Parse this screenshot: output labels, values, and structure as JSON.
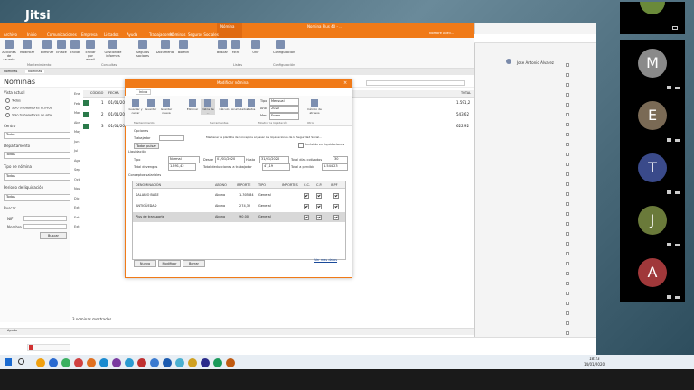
{
  "jitsi": {
    "logo": "Jitsi"
  },
  "app": {
    "title_center": "Nomina Plus 40 - ...",
    "title_right": "Nombre Apell...",
    "context_tab": "Nómina",
    "ribbon_tabs": [
      "Archivo",
      "Inicio",
      "Comunicaciones",
      "Empresa",
      "Listados",
      "Ayuda",
      "Trabajadores",
      "Nóminas",
      "Seguros Sociales",
      "Nómina"
    ],
    "ribbon_buttons": [
      "Acciones de usuario",
      "Modificar",
      "Eliminar",
      "Enlace",
      "Enviar",
      "Enviar por email",
      "Gestión de informes",
      "Seguros sociales",
      "Documento",
      "Boletín",
      "Buscar",
      "Filtro",
      "Unir",
      "Configuración"
    ],
    "ribbon_groups": [
      "Mantenimiento",
      "Consultas",
      "Listas",
      "Configuración"
    ],
    "doc_tabs": [
      "Nóminas",
      "Nóminas"
    ],
    "module_title": "Nominas",
    "filters": {
      "view_label": "Vista actual",
      "radio1": "Todos",
      "radio2": "Solo trabajadores activos",
      "radio3": "Solo trabajadores de alta",
      "centro_label": "Centro",
      "centro_value": "Todos",
      "depto_label": "Departamento",
      "depto_value": "Todos",
      "tipo_label": "Tipo de nómina",
      "tipo_value": "Todos",
      "periodo_label": "Periodo de liquidación",
      "periodo_value": "Todos",
      "buscar_label": "Buscar",
      "nif_label": "NIF",
      "nombre_label": "Nombre",
      "buscar_button": "Buscar"
    },
    "grid": {
      "headers": [
        "CÓDIGO",
        "FECHA"
      ],
      "rows": [
        {
          "code": "1",
          "date": "01/01/2020"
        },
        {
          "code": "2",
          "date": "01/01/2020"
        },
        {
          "code": "3",
          "date": "01/01/2020"
        }
      ],
      "totals_header": "TOTAL",
      "totals": [
        "1.591,2",
        "543,62",
        "622,92"
      ],
      "left_col": [
        "Ene",
        "Feb",
        "Mar",
        "Abr",
        "May",
        "Jun",
        "Jul",
        "Ago",
        "Sep",
        "Oct",
        "Nov",
        "Dic",
        "Ext.",
        "Ext.",
        "Ext."
      ]
    },
    "status_bar": "3 nominas mostradas",
    "ayuda": "Ayuda"
  },
  "dialog": {
    "title": "Modificar nómina",
    "tab": "Inicio",
    "toolbar": [
      "Guardar y cerrar",
      "Guardar",
      "Guardar nueva",
      "Eliminar",
      "Datos de ...",
      "Cálculo",
      "Acumulados",
      "Datos",
      "Ver detalle",
      "Cálculo de atrasos"
    ],
    "tipo_label": "Tipo",
    "tipo_value": "Mensual",
    "ano_label": "Año",
    "ano_value": "2020",
    "mes_label": "Mes",
    "mes_value": "Enero",
    "groups": [
      "Mantenimiento",
      "Herramientas",
      "Mostrar la liquidación",
      "Otros"
    ],
    "options_label": "Opciones",
    "trabajador_label": "Trabajador",
    "todos_button": "Todos pulsar",
    "note": "Mantener la plantilla de conceptos al pasar las liquidaciones de la Seguridad Social...",
    "incluida": "Incluida en liquidaciones",
    "liquidacion_label": "Liquidación",
    "tipo2_label": "Tipo",
    "tipo2_value": "Normal",
    "desde_label": "Desde",
    "desde_value": "01/01/2020",
    "hasta_label": "Hasta",
    "hasta_value": "31/01/2020",
    "dias_label": "Total días cotizados",
    "dias_value": "30",
    "total_devengos_label": "Total devengos",
    "total_devengos_value": "1.591,42",
    "total_deducciones_label": "Total deducciones a trabajador",
    "total_deducciones_value": "47,19",
    "total_percibir_label": "Total a percibir",
    "total_percibir_value": "1.544,23",
    "conceptos_label": "Conceptos salariales",
    "table_headers": [
      "DENOMINACIÓN",
      "ABONO",
      "IMPORTE",
      "TIPO",
      "IMPORTES",
      "C.C.",
      "C.P.",
      "IRPF"
    ],
    "table_rows": [
      {
        "name": "SALARIO BASE",
        "abono": "Abono",
        "importe": "1.305,84",
        "tipo": "General"
      },
      {
        "name": "ANTIGÜEDAD",
        "abono": "Abono",
        "importe": "274,32",
        "tipo": "General"
      },
      {
        "name": "Plus de transporte",
        "abono": "Abono",
        "importe": "90,00",
        "tipo": "General"
      }
    ],
    "buttons": [
      "Nuevo",
      "Modificar",
      "Borrar"
    ],
    "link": "Ver mas datos"
  },
  "browser": {
    "user": "Jose Antonio Alvarez"
  },
  "participants": [
    {
      "letter": "M",
      "color": "#8a8a8a"
    },
    {
      "letter": "E",
      "color": "#7a6a55"
    },
    {
      "letter": "T",
      "color": "#3a4a8a"
    },
    {
      "letter": "J",
      "color": "#6a7a3a"
    },
    {
      "letter": "A",
      "color": "#a0383a"
    }
  ],
  "taskbar": {
    "time": "18:23",
    "date": "14/01/2020"
  }
}
